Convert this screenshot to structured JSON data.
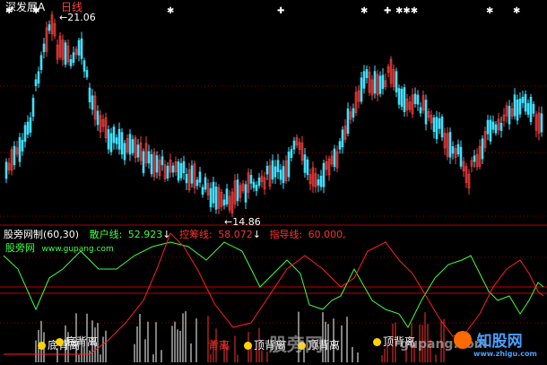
{
  "header": {
    "stock_name": "深发展A",
    "period": "日线",
    "max_price_label": "21.06",
    "min_price_label": "14.86"
  },
  "indicator": {
    "name": "股旁网制(60,30)",
    "retail_label": "散户线:",
    "retail_value": "52.923",
    "control_label": "控筹线:",
    "control_value": "58.072",
    "guide_label": "指导线:",
    "guide_value": "60.000,",
    "arrow": "↓",
    "site_name": "股旁网",
    "site_url": "www.gupang.com"
  },
  "bottom_labels": [
    "底背离",
    "底背离",
    "顶背离",
    "顶背离",
    "顶背离"
  ],
  "bottom_red_label": "背离",
  "watermarks": {
    "center": "股旁网",
    "domain": "gupang.com",
    "brand": "知股网",
    "brand_url": "www.zhigu.com"
  },
  "colors": {
    "up": "#ff4040",
    "down": "#40e0ff",
    "retail_line": "#40ff40",
    "control_line": "#ff2020",
    "guide_line": "#ff2020",
    "label_yellow": "#ffd400"
  }
}
